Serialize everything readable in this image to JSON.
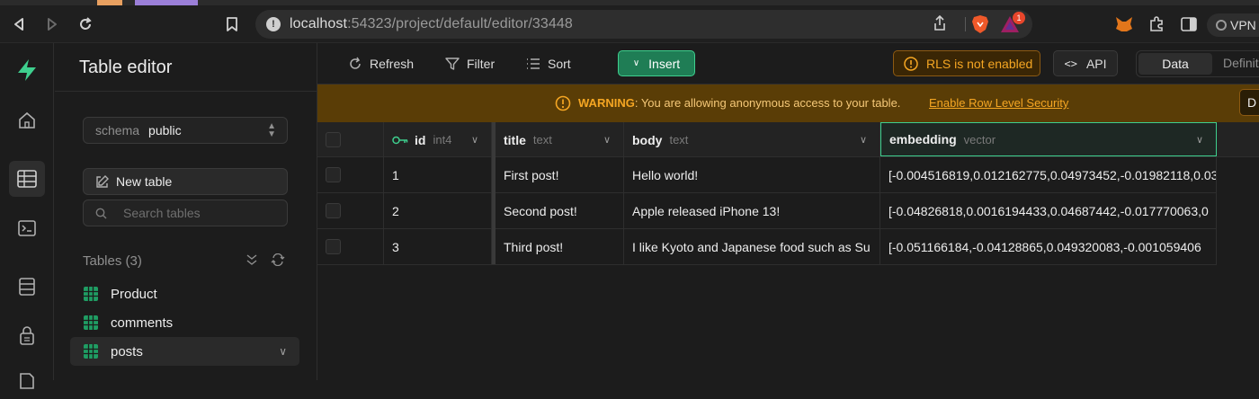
{
  "browser": {
    "url_host": "localhost",
    "url_path": ":54323/project/default/editor/33448",
    "bat_badge": "1",
    "vpn_label": "VPN"
  },
  "sidebar": {
    "title": "Table editor",
    "schema_label": "schema",
    "schema_value": "public",
    "new_table_label": "New table",
    "search_placeholder": "Search tables",
    "tables_header": "Tables (3)",
    "tables": [
      {
        "name": "Product"
      },
      {
        "name": "comments"
      },
      {
        "name": "posts"
      }
    ]
  },
  "toolbar": {
    "refresh_label": "Refresh",
    "filter_label": "Filter",
    "sort_label": "Sort",
    "insert_label": "Insert",
    "rls_label": "RLS is not enabled",
    "api_label": "API",
    "view_data_label": "Data",
    "view_definition_label": "Definit"
  },
  "warning": {
    "prefix": "WARNING",
    "message": ": You are allowing anonymous access to your table.",
    "link": "Enable Row Level Security",
    "dismiss": "D"
  },
  "grid": {
    "columns": [
      {
        "name": "id",
        "type": "int4"
      },
      {
        "name": "title",
        "type": "text"
      },
      {
        "name": "body",
        "type": "text"
      },
      {
        "name": "embedding",
        "type": "vector"
      }
    ],
    "rows": [
      {
        "id": "1",
        "title": "First post!",
        "body": "Hello world!",
        "embedding": "[-0.004516819,0.012162775,0.04973452,-0.01982118,0.03"
      },
      {
        "id": "2",
        "title": "Second post!",
        "body": "Apple released iPhone 13!",
        "embedding": "[-0.04826818,0.0016194433,0.04687442,-0.017770063,0"
      },
      {
        "id": "3",
        "title": "Third post!",
        "body": "I like Kyoto and Japanese food such as Su",
        "embedding": "[-0.051166184,-0.04128865,0.049320083,-0.001059406"
      }
    ]
  },
  "colors": {
    "accent": "#3ecf8e",
    "warning": "#f5a623",
    "background": "#1c1c1c"
  }
}
